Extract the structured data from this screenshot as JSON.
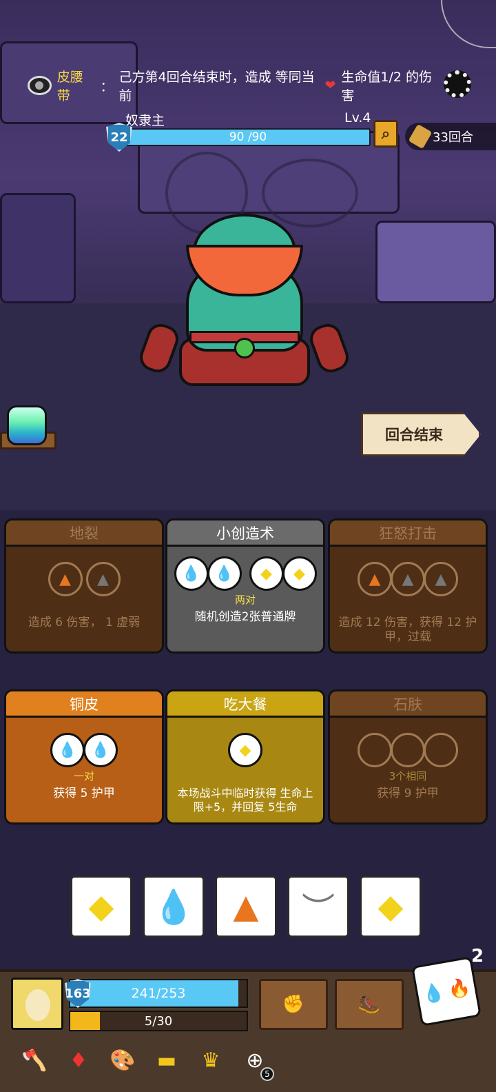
{
  "passive": {
    "name": "皮腰带",
    "text_before": "己方第4回合结束时，造成 等同当前",
    "heart": "❤",
    "text_after": "生命值1/2 的伤害"
  },
  "enemy": {
    "name": "奴隶主",
    "level": "Lv.4",
    "armor": "22",
    "hp": "90 /90",
    "hp_fraction": 1.0
  },
  "round": "33回合",
  "end_turn_label": "回合结束",
  "cards": [
    {
      "title": "地裂",
      "style": "brown",
      "req": "",
      "desc": "造成 6 伤害， 1 虚弱"
    },
    {
      "title": "小创造术",
      "style": "gray",
      "req": "两对",
      "desc": "随机创造2张普通牌"
    },
    {
      "title": "狂怒打击",
      "style": "brown",
      "req": "",
      "desc": "造成 12 伤害，获得 12 护甲，过载"
    },
    {
      "title": "铜皮",
      "style": "orange",
      "req": "一对",
      "desc": "获得 5 护甲"
    },
    {
      "title": "吃大餐",
      "style": "gold",
      "req": "",
      "desc": "本场战斗中临时获得 生命上限+5，并回复 5生命"
    },
    {
      "title": "石肤",
      "style": "brown",
      "req": "3个相同",
      "desc": "获得 9 护甲"
    }
  ],
  "dice": [
    "diamond",
    "drop",
    "rock",
    "eye",
    "diamond"
  ],
  "dice_remaining": "2",
  "player": {
    "armor": "163",
    "hp": "241/253",
    "hp_fraction": 0.953,
    "xp": "5/30",
    "xp_fraction": 0.167
  },
  "inventory_badge": "5"
}
